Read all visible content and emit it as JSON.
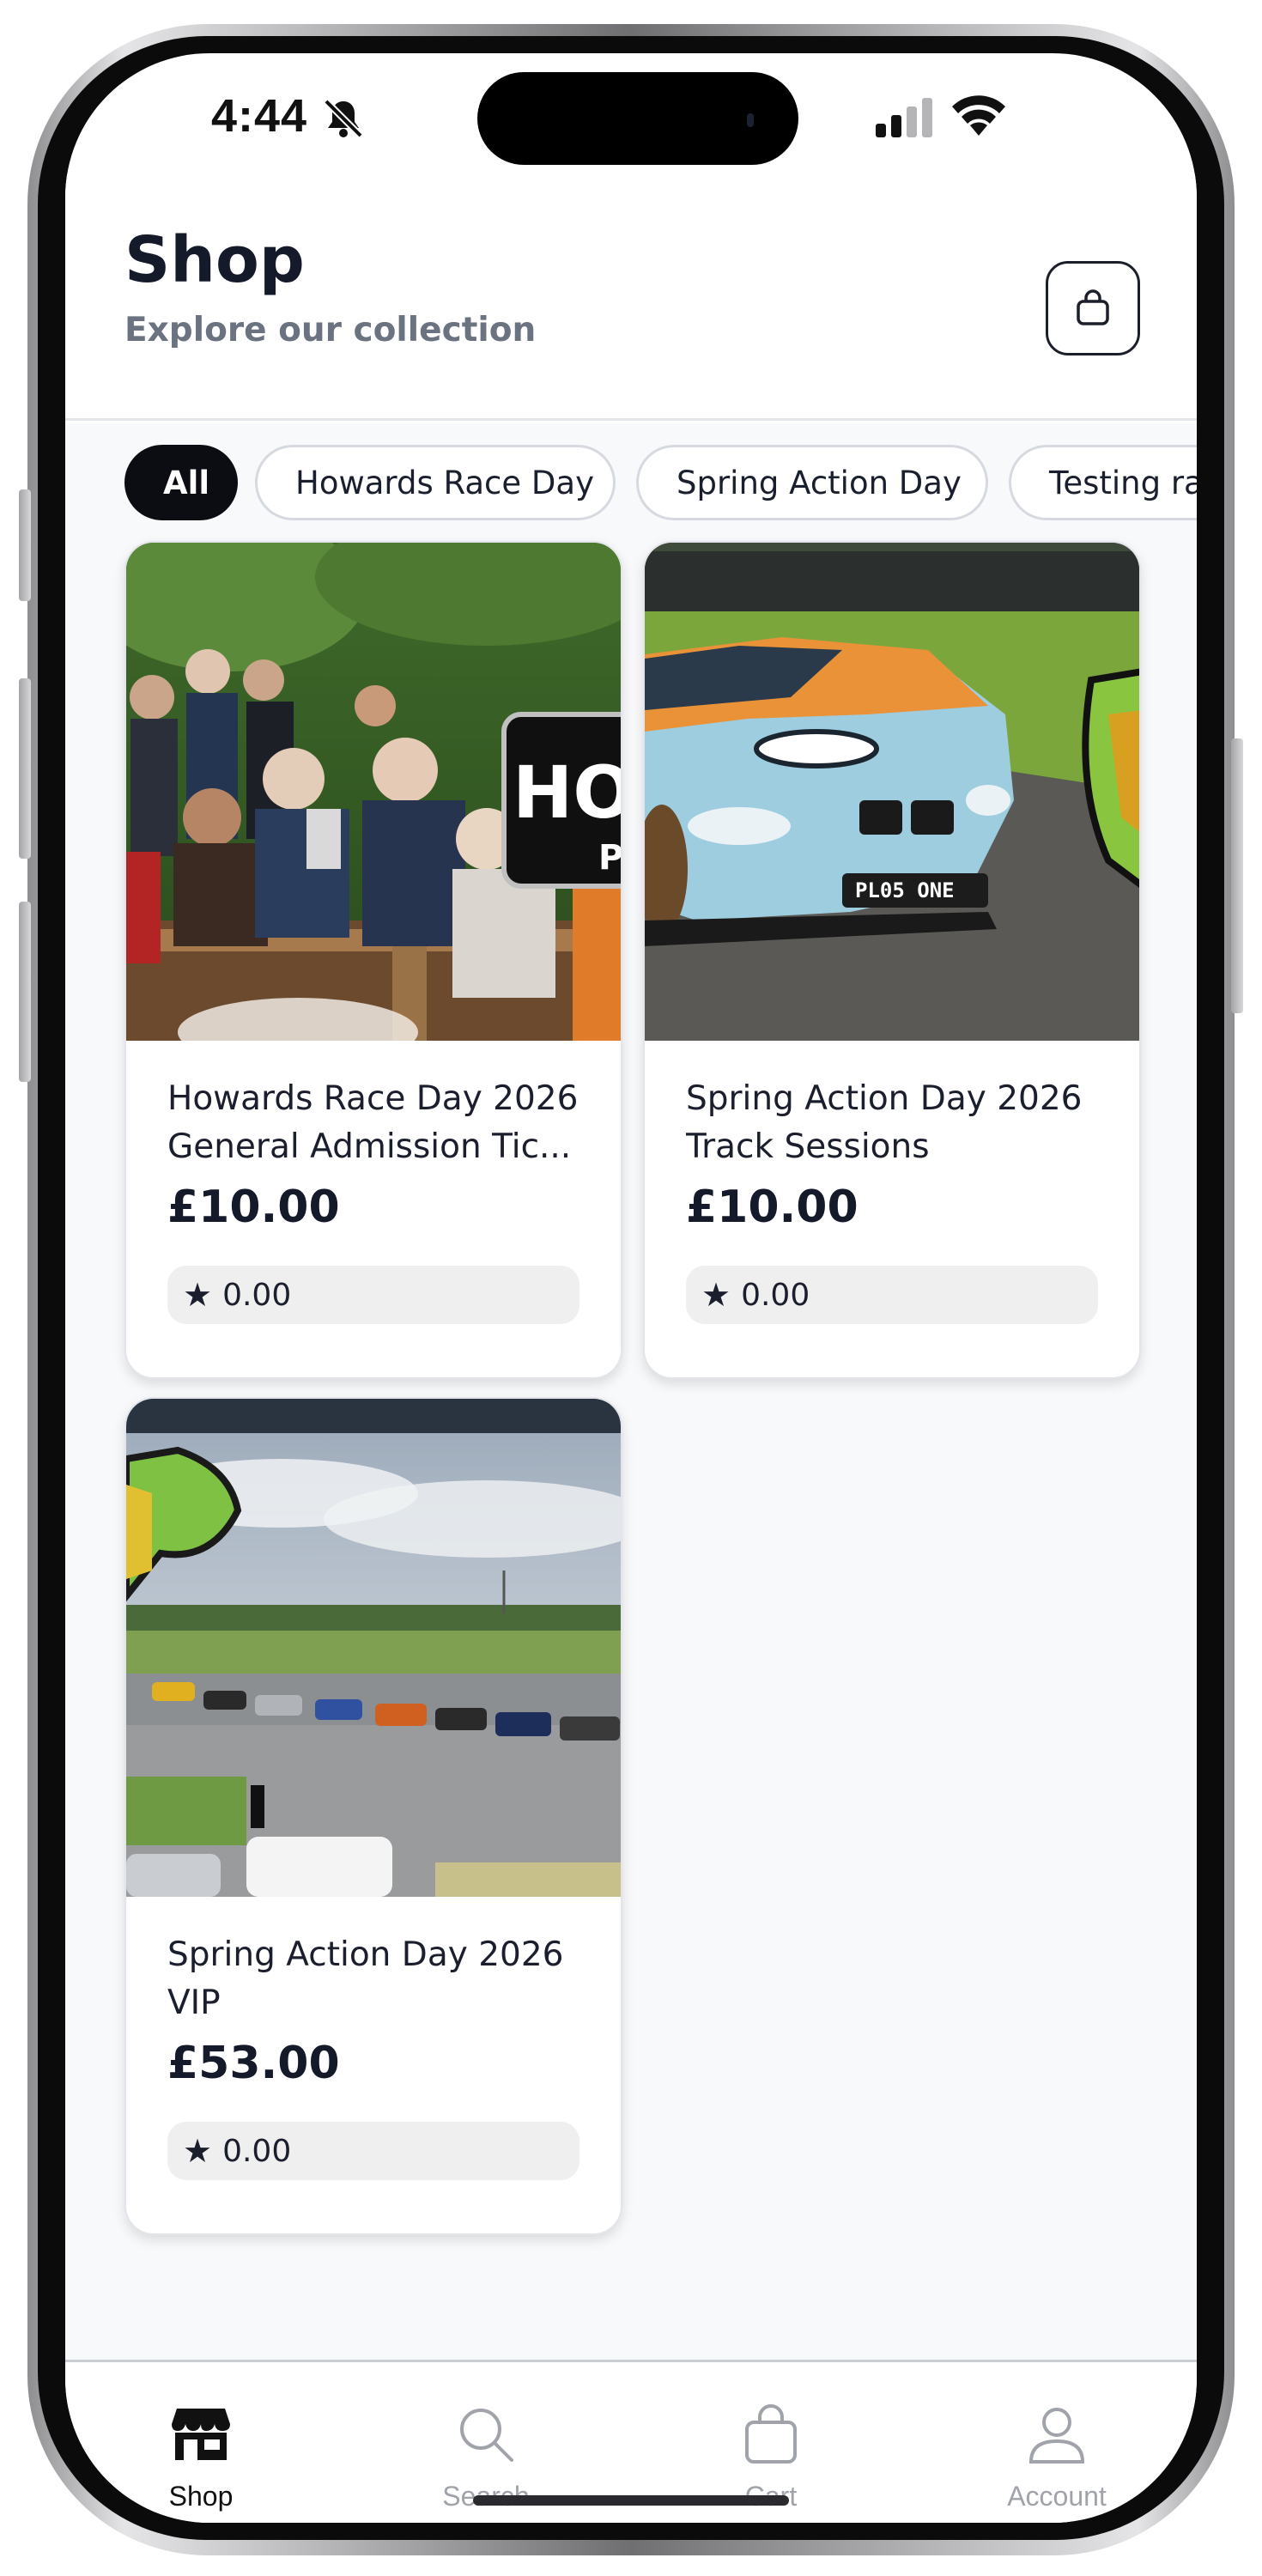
{
  "status_bar": {
    "time": "4:44",
    "icons": [
      "bell-slash-icon",
      "signal-icon",
      "wifi-icon"
    ]
  },
  "header": {
    "title": "Shop",
    "subtitle": "Explore our collection",
    "cart_icon": "shopping-bag-icon"
  },
  "filters": {
    "chips": [
      {
        "label": "All",
        "active": true
      },
      {
        "label": "Howards Race Day",
        "active": false
      },
      {
        "label": "Spring Action Day",
        "active": false
      },
      {
        "label": "Testing ra",
        "active": false
      }
    ]
  },
  "products": [
    {
      "title_line1": "Howards Race Day 2026",
      "title_line2": "General Admission Tic...",
      "price": "£10.00",
      "rating": "0.00"
    },
    {
      "title_line1": "Spring Action Day 2026",
      "title_line2": "Track Sessions",
      "price": "£10.00",
      "rating": "0.00"
    },
    {
      "title_line1": "Spring Action Day 2026",
      "title_line2": "VIP",
      "price": "£53.00",
      "rating": "0.00"
    }
  ],
  "image_text": {
    "logo_fragment": "HO",
    "logo_fragment_sub": "P",
    "plate": "PL05 ONE"
  },
  "bottom_nav": {
    "items": [
      {
        "label": "Shop",
        "icon": "storefront-icon",
        "active": true
      },
      {
        "label": "Search",
        "icon": "search-icon",
        "active": false
      },
      {
        "label": "Cart",
        "icon": "bag-icon",
        "active": false
      },
      {
        "label": "Account",
        "icon": "user-icon",
        "active": false
      }
    ]
  },
  "colors": {
    "accent": "#0b0d13",
    "text_primary": "#151a2b",
    "text_secondary": "#6b7280",
    "inactive_nav": "#a0a3a9",
    "background": "#f8f9fb"
  }
}
